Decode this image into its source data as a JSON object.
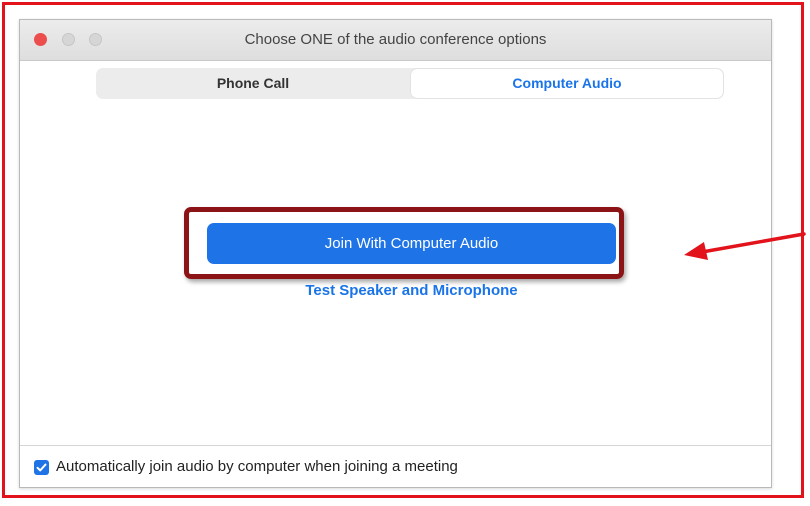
{
  "window": {
    "title": "Choose ONE of the audio conference options"
  },
  "tabs": [
    {
      "label": "Phone Call",
      "selected": false
    },
    {
      "label": "Computer Audio",
      "selected": true
    }
  ],
  "main": {
    "join_button_label": "Join With Computer Audio",
    "test_link_label": "Test Speaker and Microphone"
  },
  "footer": {
    "auto_join_label": "Automatically join audio by computer when joining a meeting",
    "auto_join_checked": true
  },
  "icons": {
    "close": "close-traffic-light",
    "minimize": "minimize-traffic-light",
    "maximize": "maximize-traffic-light",
    "checkmark": "checkmark-icon",
    "annotation_arrow": "arrow-left-icon"
  },
  "colors": {
    "accent_blue": "#1e73e6",
    "annotation_red": "#e3131b",
    "highlight_dark_red": "#8d1416",
    "close_red": "#ec4e4e"
  }
}
